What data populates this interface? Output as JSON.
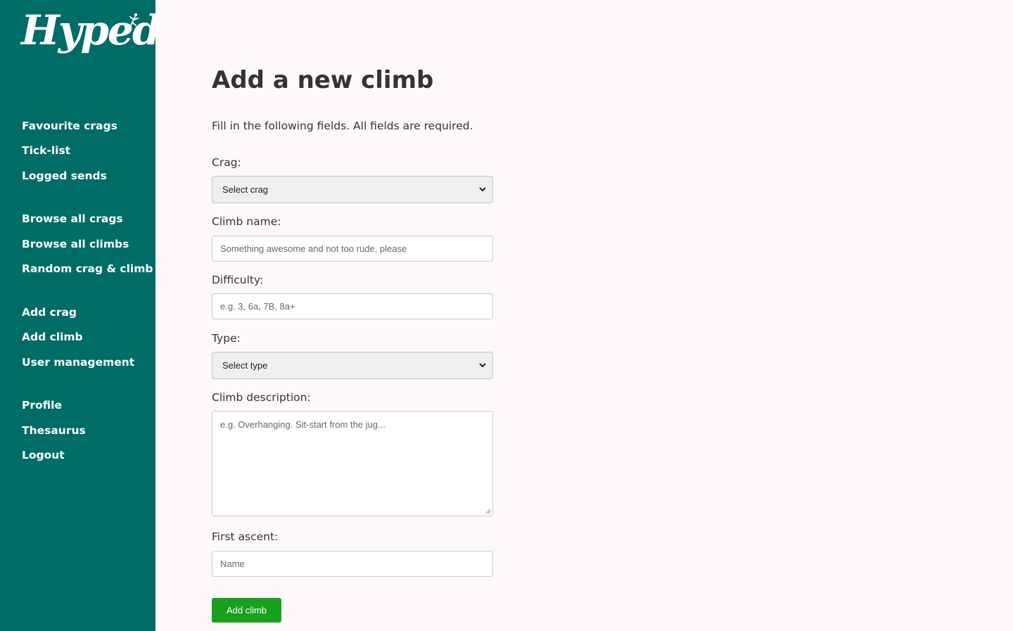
{
  "app": {
    "logo_text": "Hyped"
  },
  "sidebar": {
    "items": [
      {
        "label": "Favourite crags"
      },
      {
        "label": "Tick-list"
      },
      {
        "label": "Logged sends"
      },
      {
        "label": "Browse all crags"
      },
      {
        "label": "Browse all climbs"
      },
      {
        "label": "Random crag & climb"
      },
      {
        "label": "Add crag"
      },
      {
        "label": "Add climb"
      },
      {
        "label": "User management"
      },
      {
        "label": "Profile"
      },
      {
        "label": "Thesaurus"
      },
      {
        "label": "Logout"
      }
    ]
  },
  "main": {
    "title": "Add a new climb",
    "intro": "Fill in the following fields. All fields are required.",
    "form": {
      "crag_label": "Crag:",
      "crag_selected": "Select crag",
      "name_label": "Climb name:",
      "name_placeholder": "Something awesome and not too rude, please",
      "difficulty_label": "Difficulty:",
      "difficulty_placeholder": "e.g. 3, 6a, 7B, 8a+",
      "type_label": "Type:",
      "type_selected": "Select type",
      "description_label": "Climb description:",
      "description_placeholder": "e.g. Overhanging. Sit-start from the jug...",
      "fa_label": "First ascent:",
      "fa_placeholder": "Name",
      "submit_label": "Add climb"
    }
  },
  "colors": {
    "sidebar": "#006c68",
    "background": "#fdf9f8",
    "button": "#18a01d"
  },
  "icons": {
    "logo": "climber-figure-icon",
    "select": "chevron-down-icon"
  }
}
